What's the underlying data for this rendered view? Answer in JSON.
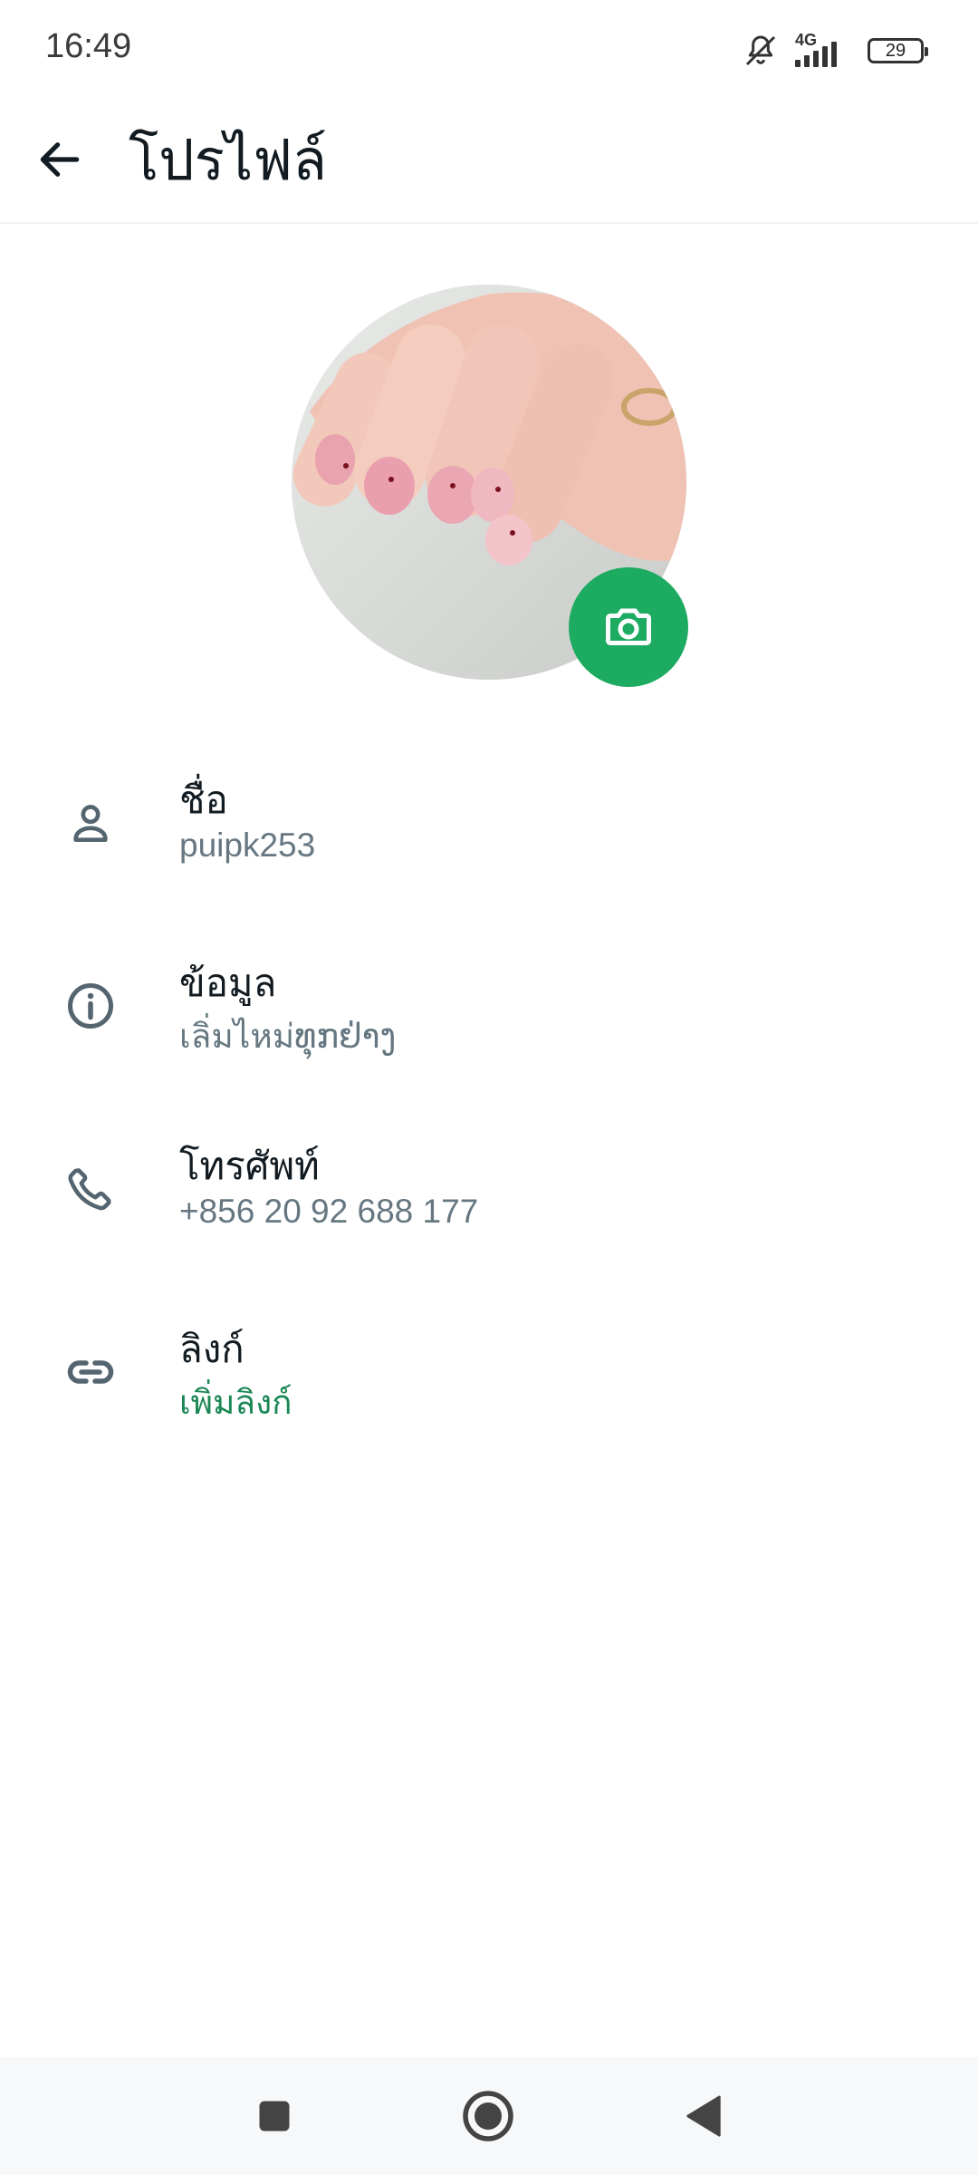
{
  "status_bar": {
    "time": "16:49",
    "network": "4G",
    "battery": "29",
    "icons": [
      "bell-muted-icon",
      "signal-icon",
      "battery-icon"
    ]
  },
  "app_bar": {
    "title": "โปรไฟล์",
    "back_icon": "arrow-left-icon"
  },
  "avatar": {
    "camera_icon": "camera-icon",
    "accent_color": "#1daa61"
  },
  "rows": [
    {
      "icon": "person-icon",
      "label": "ชื่อ",
      "value": "puipk253"
    },
    {
      "icon": "info-icon",
      "label": "ข้อมูล",
      "value": "เลิ่มไหม่ທຸກຢ່າງ"
    },
    {
      "icon": "phone-icon",
      "label": "โทรศัพท์",
      "value": "+856 20 92 688 177"
    },
    {
      "icon": "link-icon",
      "label": "ลิงก์",
      "value": "เพิ่มลิงก์",
      "value_color": "#1b8755"
    }
  ],
  "nav_bar": {
    "buttons": [
      "recents-square-icon",
      "home-circle-icon",
      "back-triangle-icon"
    ]
  }
}
